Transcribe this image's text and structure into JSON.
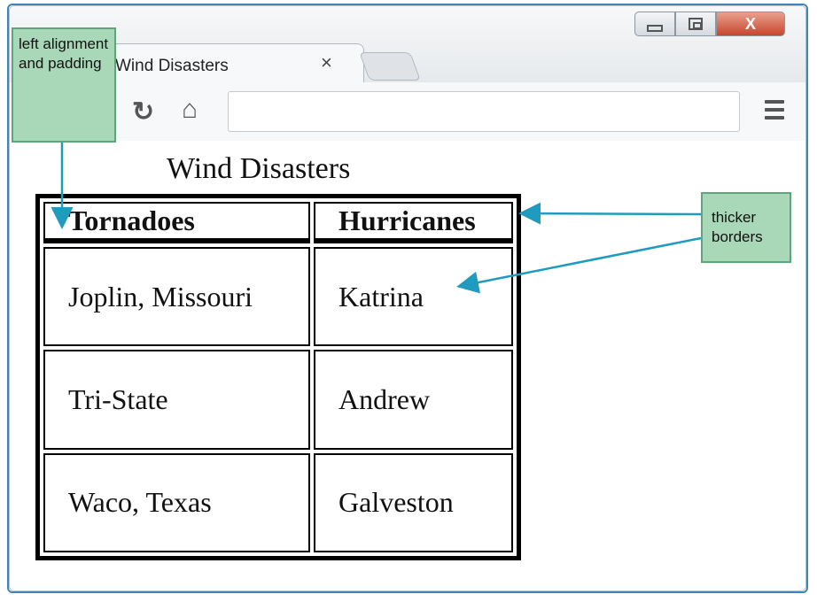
{
  "browser": {
    "tab_title": "Wind Disasters",
    "tab_close": "×",
    "window_controls": {
      "close_glyph": "X"
    },
    "address_value": ""
  },
  "page": {
    "caption": "Wind Disasters",
    "table": {
      "headers": [
        "Tornadoes",
        "Hurricanes"
      ],
      "rows": [
        [
          "Joplin, Missouri",
          "Katrina"
        ],
        [
          "Tri-State",
          "Andrew"
        ],
        [
          "Waco, Texas",
          "Galveston"
        ]
      ]
    }
  },
  "callouts": {
    "left": "left alignment and padding",
    "right": "thicker borders"
  },
  "colors": {
    "frame": "#3f86b8",
    "callout_fill": "#a9d8b9",
    "callout_border": "#5da57a",
    "arrow": "#1f9bbf"
  },
  "icons": [
    "reload-icon",
    "home-icon",
    "menu-icon",
    "minimize-icon",
    "maximize-icon",
    "close-icon"
  ]
}
